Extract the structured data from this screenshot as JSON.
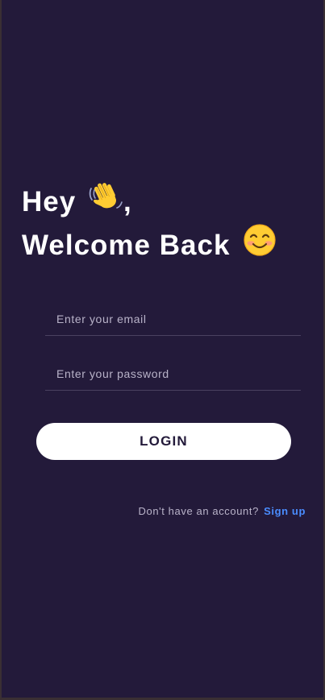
{
  "header": {
    "line1": "Hey",
    "line1_suffix": ",",
    "line2": "Welcome Back",
    "wave_icon": "waving-hand-icon",
    "smile_icon": "smiling-face-icon"
  },
  "form": {
    "email_placeholder": "Enter your email",
    "password_placeholder": "Enter your password",
    "login_label": "LOGIN"
  },
  "footer": {
    "prompt": "Don't have an account?",
    "signup_label": "Sign up"
  },
  "colors": {
    "background": "#231a3a",
    "text": "#ffffff",
    "muted": "#b9b3c9",
    "link": "#4a8dff",
    "button": "#ffffff"
  }
}
